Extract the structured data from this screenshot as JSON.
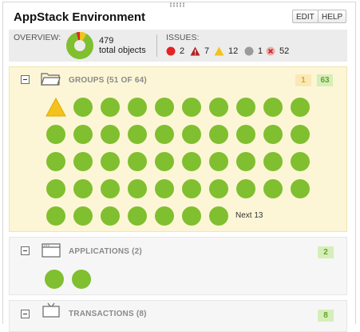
{
  "header": {
    "title": "AppStack Environment",
    "edit_label": "EDIT",
    "help_label": "HELP"
  },
  "overview": {
    "label": "OVERVIEW:",
    "total_count": "479",
    "total_caption": "total objects",
    "issues_label": "ISSUES:",
    "issues": [
      {
        "icon": "critical-circle-icon",
        "color": "#e32326",
        "count": "2"
      },
      {
        "icon": "critical-triangle-icon",
        "color": "#b22222",
        "count": "7"
      },
      {
        "icon": "warning-triangle-icon",
        "color": "#f5c21b",
        "count": "12"
      },
      {
        "icon": "unknown-circle-icon",
        "color": "#9b9b9b",
        "count": "1"
      },
      {
        "icon": "unreachable-circle-icon",
        "color": "#d98b8b",
        "count": "52"
      }
    ]
  },
  "sections": {
    "groups": {
      "icon": "folder-icon",
      "title": "GROUPS (51 OF 64)",
      "warning_count": "1",
      "ok_count": "63",
      "next_label": "Next 13"
    },
    "applications": {
      "icon": "window-icon",
      "title": "APPLICATIONS (2)",
      "ok_count": "2"
    },
    "transactions": {
      "icon": "monitor-icon",
      "title": "TRANSACTIONS (8)",
      "ok_count": "8"
    }
  },
  "colors": {
    "ok": "#80bf2f",
    "warning": "#f5c21b",
    "accent_bg": "#fcf6d6"
  }
}
